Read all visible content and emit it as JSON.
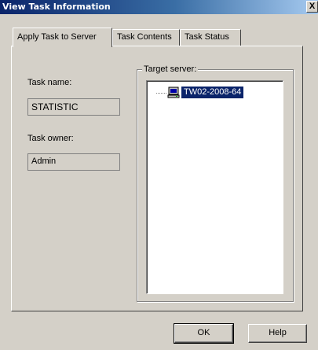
{
  "window": {
    "title": "View Task Information",
    "close_label": "X"
  },
  "tabs": [
    {
      "label": "Apply Task to Server",
      "active": true
    },
    {
      "label": "Task Contents",
      "active": false
    },
    {
      "label": "Task Status",
      "active": false
    }
  ],
  "form": {
    "task_name_label": "Task name:",
    "task_name_value": "STATISTIC",
    "task_owner_label": "Task owner:",
    "task_owner_value": "Admin"
  },
  "target": {
    "group_label": "Target server:",
    "servers": [
      {
        "name": "TW02-2008-64",
        "icon": "server-computer-icon",
        "selected": true
      }
    ]
  },
  "buttons": {
    "ok": "OK",
    "help": "Help"
  },
  "colors": {
    "dialog_bg": "#d4d0c8",
    "title_start": "#0a246a",
    "selection": "#0a246a"
  }
}
